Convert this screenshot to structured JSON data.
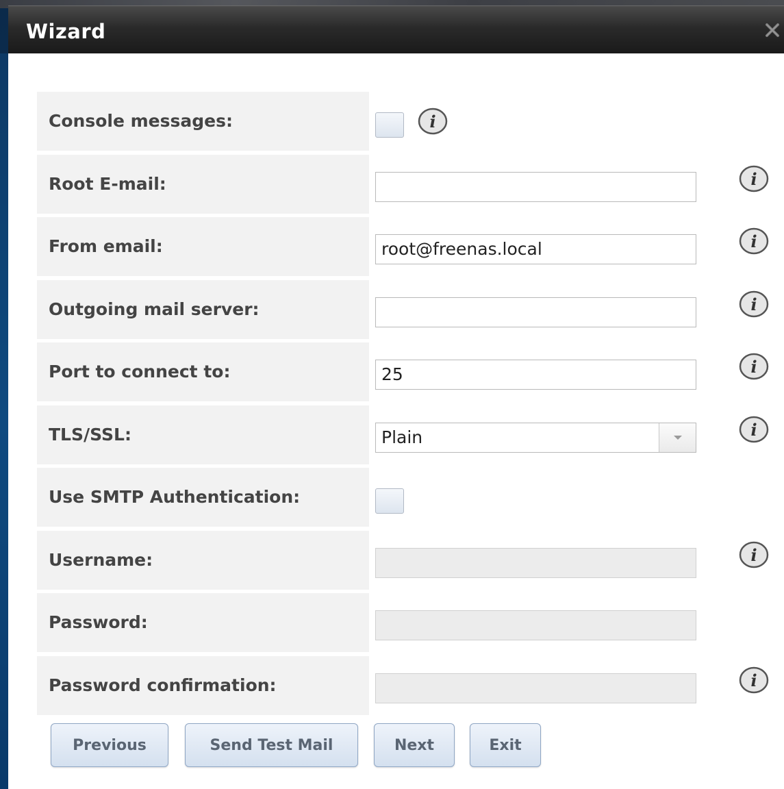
{
  "dialog": {
    "title": "Wizard",
    "close_icon": "close-icon"
  },
  "form": {
    "console_messages": {
      "label": "Console messages:",
      "checked": false
    },
    "root_email": {
      "label": "Root E-mail:",
      "value": ""
    },
    "from_email": {
      "label": "From email:",
      "value": "root@freenas.local"
    },
    "outgoing_server": {
      "label": "Outgoing mail server:",
      "value": ""
    },
    "port": {
      "label": "Port to connect to:",
      "value": "25"
    },
    "tls_ssl": {
      "label": "TLS/SSL:",
      "value": "Plain"
    },
    "smtp_auth": {
      "label": "Use SMTP Authentication:",
      "checked": false
    },
    "username": {
      "label": "Username:",
      "value": ""
    },
    "password": {
      "label": "Password:",
      "value": ""
    },
    "password_confirm": {
      "label": "Password confirmation:",
      "value": ""
    }
  },
  "buttons": {
    "previous": "Previous",
    "send_test_mail": "Send Test Mail",
    "next": "Next",
    "exit": "Exit"
  },
  "colors": {
    "title_bar": "#1a1a1a",
    "label_bg": "#f2f2f2",
    "button_border": "#8fa6c4"
  }
}
